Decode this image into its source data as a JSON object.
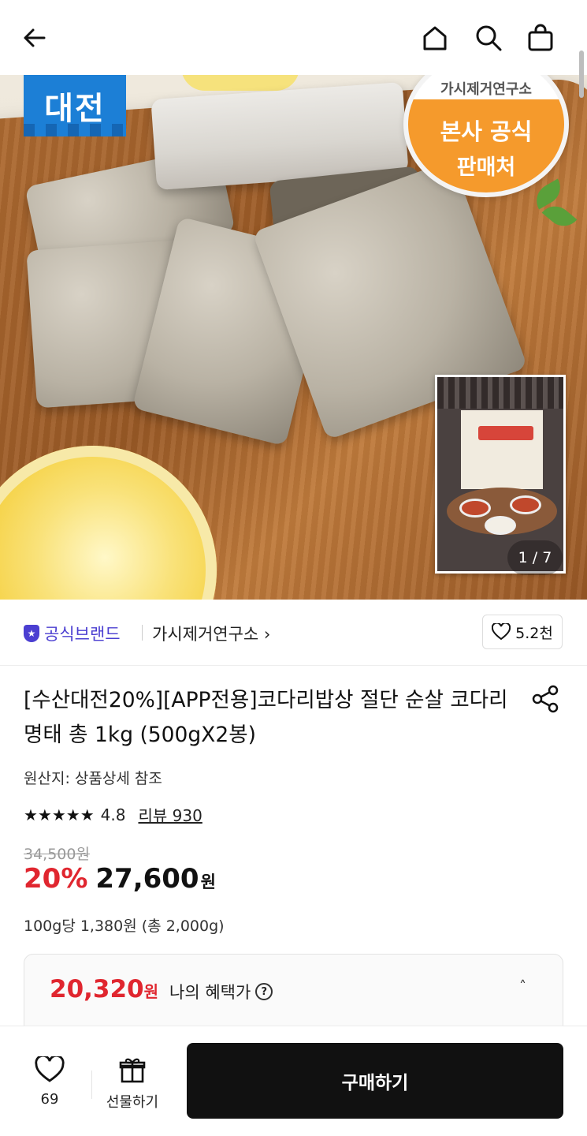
{
  "header": {
    "back_icon": "arrow-left-icon",
    "home_icon": "home-icon",
    "search_icon": "search-icon",
    "cart_icon": "shopping-bag-icon"
  },
  "hero": {
    "badge_left_text": "대전",
    "seal_top_text": "가시제거연구소",
    "seal_line1": "본사 공식",
    "seal_line2": "판매처",
    "counter": "1 / 7"
  },
  "brand": {
    "official_label": "공식브랜드",
    "store_name": "가시제거연구소 ›",
    "likes": "5.2천"
  },
  "product": {
    "title": "[수산대전20%][APP전용]코다리밥상 절단 순살 코다리 명태 총 1kg (500gX2봉)",
    "origin": "원산지: 상품상세 참조",
    "stars": "★★★★★",
    "rating": "4.8",
    "review": "리뷰 930",
    "original_price": "34,500원",
    "discount": "20%",
    "price": "27,600",
    "price_unit": "원",
    "unit_price": "100g당 1,380원 (총 2,000g)"
  },
  "benefit": {
    "price": "20,320",
    "unit": "원",
    "label": "나의 혜택가",
    "help": "?",
    "toggle": "˄"
  },
  "bottom_bar": {
    "wish_count": "69",
    "gift_label": "선물하기",
    "buy_label": "구매하기"
  }
}
